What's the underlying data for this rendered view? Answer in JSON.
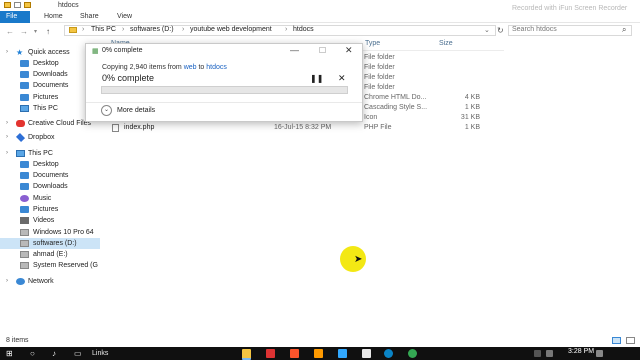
{
  "window": {
    "title": "htdocs",
    "watermark": "Recorded with iFun Screen Recorder"
  },
  "ribbon": {
    "file": "File",
    "tabs": [
      "Home",
      "Share",
      "View"
    ]
  },
  "address": {
    "crumbs": [
      "This PC",
      "softwares (D:)",
      "youtube web development",
      "htdocs"
    ],
    "search_placeholder": "Search htdocs"
  },
  "nav": {
    "items": [
      {
        "label": "Quick access",
        "icon": "star-icon",
        "level": "top"
      },
      {
        "label": "Desktop",
        "icon": "desktop-icon"
      },
      {
        "label": "Downloads",
        "icon": "downloads-icon"
      },
      {
        "label": "Documents",
        "icon": "documents-icon"
      },
      {
        "label": "Pictures",
        "icon": "pictures-icon"
      },
      {
        "label": "This PC",
        "icon": "computer-icon"
      },
      {
        "label": "Creative Cloud Files",
        "icon": "creative-cloud-icon",
        "level": "top"
      },
      {
        "label": "Dropbox",
        "icon": "dropbox-icon",
        "level": "top"
      },
      {
        "label": "This PC",
        "icon": "computer-icon",
        "level": "top"
      },
      {
        "label": "Desktop",
        "icon": "desktop-icon"
      },
      {
        "label": "Documents",
        "icon": "documents-icon"
      },
      {
        "label": "Downloads",
        "icon": "downloads-icon"
      },
      {
        "label": "Music",
        "icon": "music-icon"
      },
      {
        "label": "Pictures",
        "icon": "pictures-icon"
      },
      {
        "label": "Videos",
        "icon": "videos-icon"
      },
      {
        "label": "Windows 10 Pro 64",
        "icon": "drive-icon"
      },
      {
        "label": "softwares (D:)",
        "icon": "drive-icon",
        "selected": true
      },
      {
        "label": "ahmad (E:)",
        "icon": "drive-icon"
      },
      {
        "label": "System Reserved (G",
        "icon": "drive-icon"
      },
      {
        "label": "Network",
        "icon": "network-icon",
        "level": "top"
      }
    ]
  },
  "columns": {
    "name": "Name",
    "type": "Type",
    "size": "Size"
  },
  "files": [
    {
      "name": "",
      "date": "",
      "type": "File folder",
      "size": ""
    },
    {
      "name": "",
      "date": "",
      "type": "File folder",
      "size": ""
    },
    {
      "name": "",
      "date": "",
      "type": "File folder",
      "size": ""
    },
    {
      "name": "",
      "date": "",
      "type": "File folder",
      "size": ""
    },
    {
      "name": "",
      "date": "",
      "type": "Chrome HTML Do...",
      "size": "4 KB"
    },
    {
      "name": "",
      "date": "",
      "type": "Cascading Style S...",
      "size": "1 KB"
    },
    {
      "name": "",
      "date": "",
      "type": "Icon",
      "size": "31 KB"
    },
    {
      "name": "index.php",
      "date": "16-Jul-15 8:32 PM",
      "type": "PHP File",
      "size": "1 KB"
    }
  ],
  "dialog": {
    "title": "0% complete",
    "copying_prefix": "Copying 2,940 items from ",
    "source": "web",
    "to_word": " to ",
    "destination": "htdocs",
    "percent_text": "0% complete",
    "progress_fraction": 0,
    "more_details": "More details"
  },
  "status": {
    "items_text": "8 items"
  },
  "taskbar": {
    "links": "Links",
    "time": "3:28 PM"
  }
}
